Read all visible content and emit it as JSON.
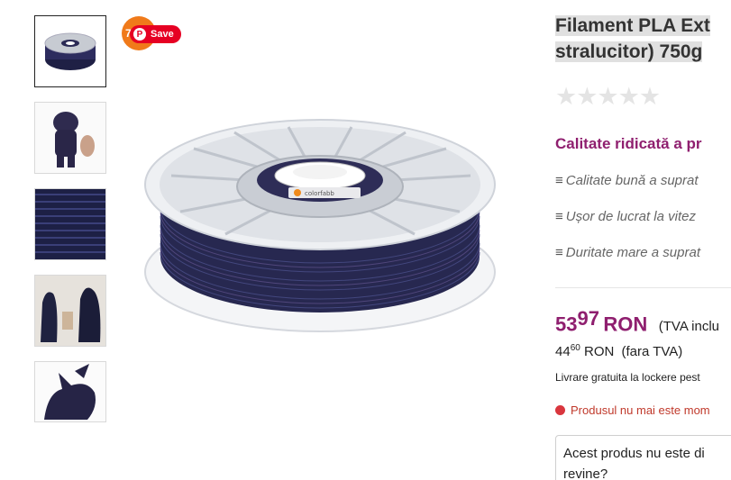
{
  "thumbnails": [
    {
      "label": "filament-spool-thumbnail"
    },
    {
      "label": "printed-figurine-thumbnail"
    },
    {
      "label": "filament-texture-thumbnail"
    },
    {
      "label": "printed-statues-thumbnail"
    },
    {
      "label": "printed-dragon-thumbnail"
    }
  ],
  "pinterest": {
    "count": "7",
    "save_label": "Save"
  },
  "spool_label": "colorfabb",
  "product": {
    "title_line1": "Filament PLA Ext",
    "title_line2": "stralucitor) 750g",
    "rating_stars": "★★★★★",
    "subtitle": "Calitate ridicată a pr",
    "features": [
      {
        "bullet": "≡",
        "text": "Calitate bună a suprat"
      },
      {
        "bullet": "≡",
        "text": "Ușor de lucrat la vitez"
      },
      {
        "bullet": "≡",
        "text": "Duritate mare a suprat"
      }
    ]
  },
  "price": {
    "main_int": "53",
    "main_dec": "97",
    "currency": "RON",
    "vat_incl": "(TVA inclu",
    "net_int": "44",
    "net_dec": "60",
    "net_currency": "RON",
    "vat_excl": "(fara TVA)"
  },
  "shipping_text": "Livrare gratuita la lockere pest",
  "stock_text": "Produsul nu mai este mom",
  "notify": {
    "line1": "Acest produs nu este di",
    "line2": "revine?"
  },
  "colors": {
    "accent": "#8f1f6f",
    "filament": "#2b2a55",
    "pinterest": "#e60023"
  }
}
